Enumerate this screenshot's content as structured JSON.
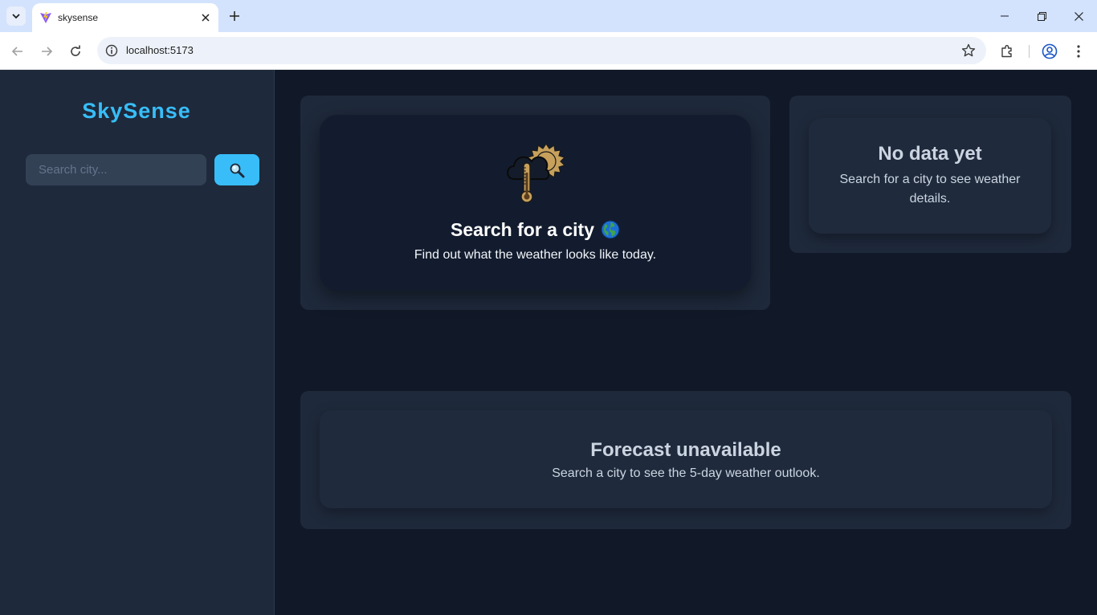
{
  "browser": {
    "tab_title": "skysense",
    "url": "localhost:5173"
  },
  "app": {
    "logo": "SkySense",
    "search": {
      "placeholder": "Search city...",
      "value": ""
    },
    "hero": {
      "title": "Search for a city",
      "subtitle": "Find out what the weather looks like today."
    },
    "details": {
      "title": "No data yet",
      "subtitle": "Search for a city to see weather details."
    },
    "forecast": {
      "title": "Forecast unavailable",
      "subtitle": "Search a city to see the 5-day weather outlook."
    }
  },
  "colors": {
    "accent": "#38bdf8",
    "sidebar_bg": "#1e293b",
    "main_bg": "#111827"
  },
  "icons": {
    "search_button": "magnifier-icon",
    "hero": "thermometer-cloud-sun-icon",
    "globe": "globe-icon"
  }
}
